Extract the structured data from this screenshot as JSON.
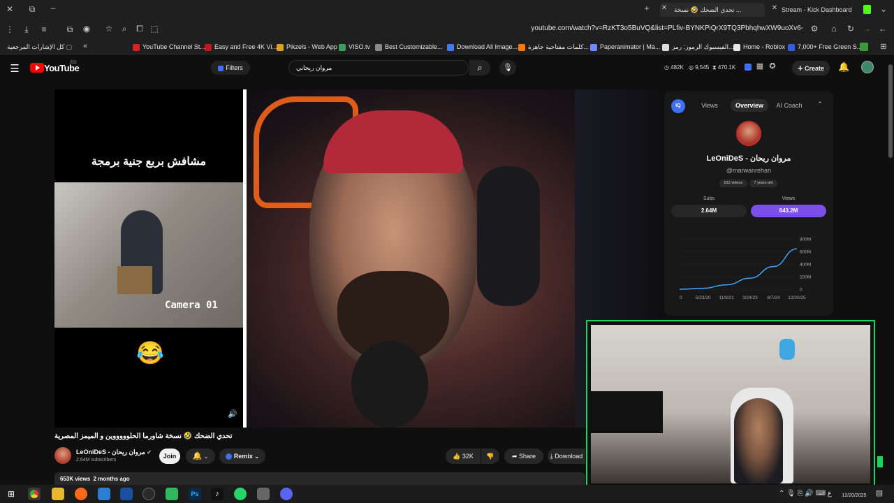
{
  "browser": {
    "tabs": [
      {
        "label": "تحدي الضحك 🤣 نسخة ...",
        "active": true
      },
      {
        "label": "Stream - Kick Dashboard",
        "active": false
      }
    ],
    "url": "youtube.com/watch?v=RzKT3o5BuVQ&list=PLfiv-BYNKPiQrX9TQ3PbhqhwXW9uoXv6-",
    "bookmarks": [
      "كل الإشارات المرجعية",
      "YouTube Channel St...",
      "Easy and Free 4K Vi...",
      "Pikzels - Web App",
      "VISO.tv",
      "Best Customizable...",
      "Download All Image...",
      "كلمات مفتاحية جاهزة...",
      "Paperanimator | Ma...",
      "الفيسبوك الرموز: رمز...",
      "Home - Roblox",
      "7,000+ Free Green S..."
    ],
    "colors": {
      "kick_green": "#53fc18",
      "overlay_border": "#1bd45a"
    }
  },
  "youtube": {
    "logo": "YouTube",
    "country": "EG",
    "filters_label": "Filters",
    "search_value": "مروان ريحاني",
    "stats": [
      "482K",
      "9,545",
      "470.1K"
    ],
    "create_label": "Create"
  },
  "video": {
    "overlay_caption": "مشافش بربع جنية برمجة",
    "clip_label": "Camera 01",
    "emoji": "😂",
    "title": "تحدي الضحك 🤣 نسخة شاورما الحلوووووين و الميمز المصرية",
    "channel_name": "LeOniDeS - مروان ريحان",
    "subscribers": "2.64M subscribers",
    "join_label": "Join",
    "remix_label": "Remix",
    "likes": "32K",
    "share_label": "Share",
    "download_label": "Download",
    "views_line": "653K views  2 months ago"
  },
  "side_panel": {
    "tabs": [
      "Views",
      "Overview",
      "AI Coach"
    ],
    "active_tab": "Overview",
    "channel_name": "LeOniDeS - مروان ريحان",
    "handle": "@marwanrehan",
    "videos_badge": "812 videos",
    "age_badge": "7 years old",
    "subs_label": "Subs",
    "subs_value": "2.64M",
    "views_label": "Views",
    "views_value": "643.2M",
    "accent": "#7b4fe8",
    "line_color": "#3ea6ff"
  },
  "chart_data": {
    "type": "line",
    "x_ticks": [
      "0",
      "5/23/20",
      "11/9/21",
      "3/24/23",
      "8/7/24",
      "12/20/25"
    ],
    "y_ticks": [
      "800M",
      "600M",
      "400M",
      "200M",
      "0"
    ],
    "ylim": [
      0,
      800
    ],
    "x": [
      0,
      1,
      2,
      3,
      4,
      5
    ],
    "values": [
      0,
      15,
      70,
      175,
      360,
      643
    ],
    "series": [
      {
        "name": "Views",
        "values": [
          0,
          15,
          70,
          175,
          360,
          643
        ]
      }
    ]
  },
  "taskbar": {
    "time": "",
    "date": "12/20/2025"
  }
}
